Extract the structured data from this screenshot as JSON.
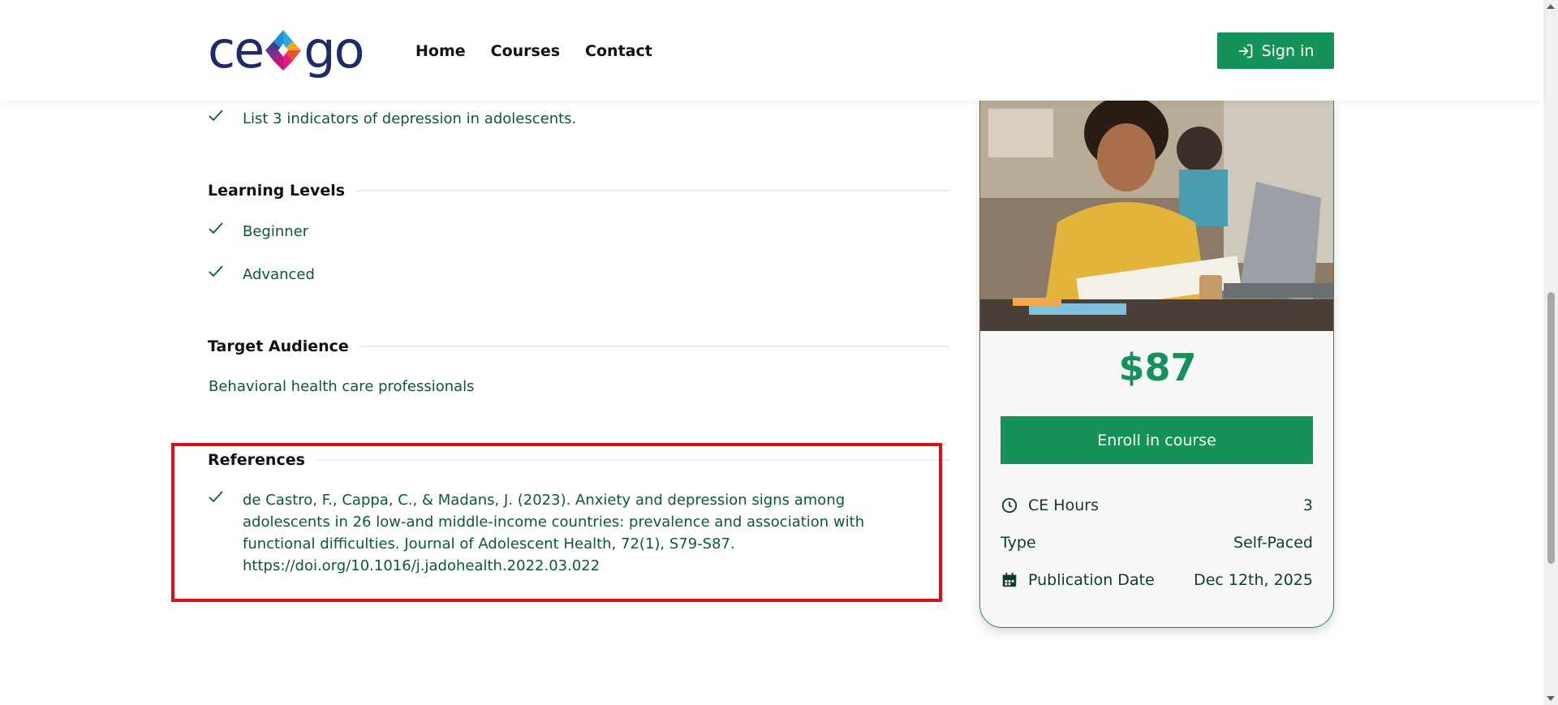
{
  "header": {
    "logo": {
      "left": "ce",
      "right": "go"
    },
    "nav": [
      "Home",
      "Courses",
      "Contact"
    ],
    "signin_label": "Sign in"
  },
  "objectives": {
    "last_item": "List 3 indicators of depression in adolescents."
  },
  "learning_levels": {
    "title": "Learning Levels",
    "items": [
      "Beginner",
      "Advanced"
    ]
  },
  "target_audience": {
    "title": "Target Audience",
    "text": "Behavioral health care professionals"
  },
  "references": {
    "title": "References",
    "lines": [
      "de Castro, F., Cappa, C., & Madans, J. (2023). Anxiety and depression signs among",
      "adolescents in 26 low-and middle-income countries: prevalence and association with",
      "functional difficulties. Journal of Adolescent Health, 72(1), S79-S87.",
      "https://doi.org/10.1016/j.jadohealth.2022.03.022"
    ]
  },
  "card": {
    "price": "$87",
    "enroll_label": "Enroll in course",
    "rows": [
      {
        "icon": "clock-icon",
        "label": "CE Hours",
        "value": "3"
      },
      {
        "icon": "",
        "label": "Type",
        "value": "Self-Paced"
      },
      {
        "icon": "calendar-icon",
        "label": "Publication Date",
        "value": "Dec 12th, 2025"
      }
    ]
  },
  "colors": {
    "accent": "#14925a",
    "body_text": "#0b5a31",
    "highlight": "#dd0f16"
  }
}
